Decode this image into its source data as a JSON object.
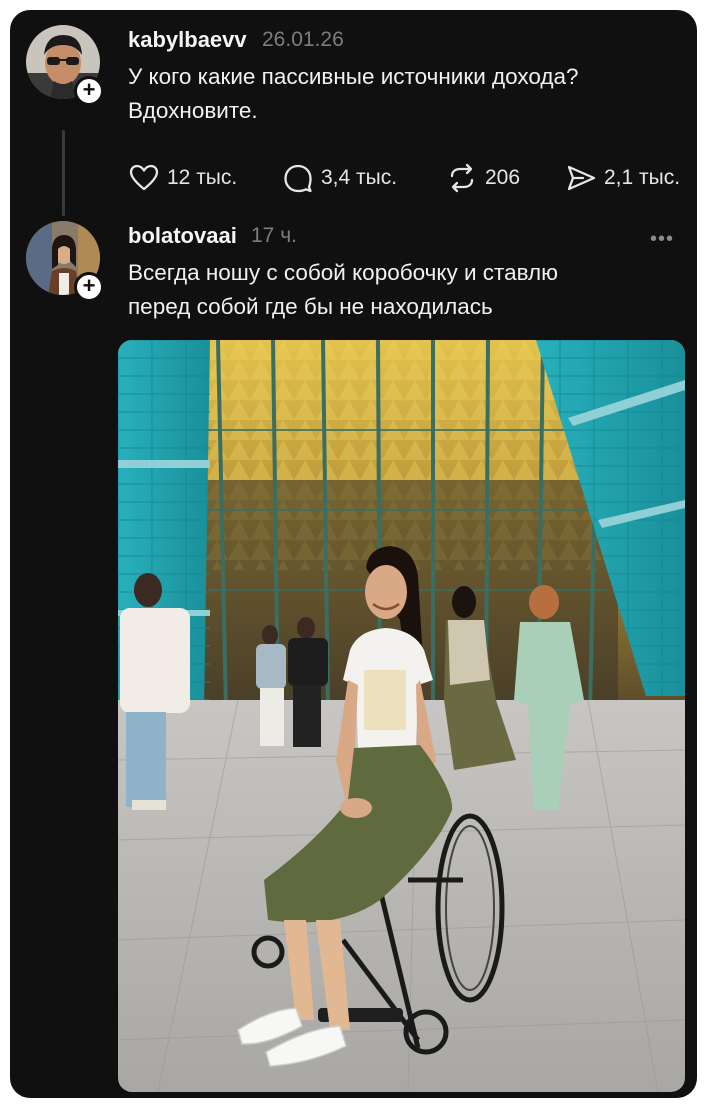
{
  "posts": [
    {
      "username": "kabylbaevv",
      "timestamp": "26.01.26",
      "text_line1": "У кого какие пассивные источники дохода?",
      "text_line2": "Вдохновите.",
      "stats": {
        "likes": "12 тыс.",
        "comments": "3,4 тыс.",
        "reposts": "206",
        "shares": "2,1 тыс."
      }
    },
    {
      "username": "bolatovaai",
      "timestamp": "17 ч.",
      "text_line1": "Всегда ношу с собой коробочку и ставлю",
      "text_line2": "перед собой где бы не находилась"
    }
  ],
  "follow_glyph": "+",
  "more_glyph": "•••",
  "icons": {
    "like": "heart-icon",
    "comment": "comment-icon",
    "repost": "repost-icon",
    "share": "share-icon",
    "more": "more-icon"
  },
  "colors": {
    "background": "#101010",
    "text": "#f1f1f1",
    "muted": "#7d7d7d",
    "building_teal": "#1fa3ad",
    "ceiling_gold": "#c9a53a"
  }
}
